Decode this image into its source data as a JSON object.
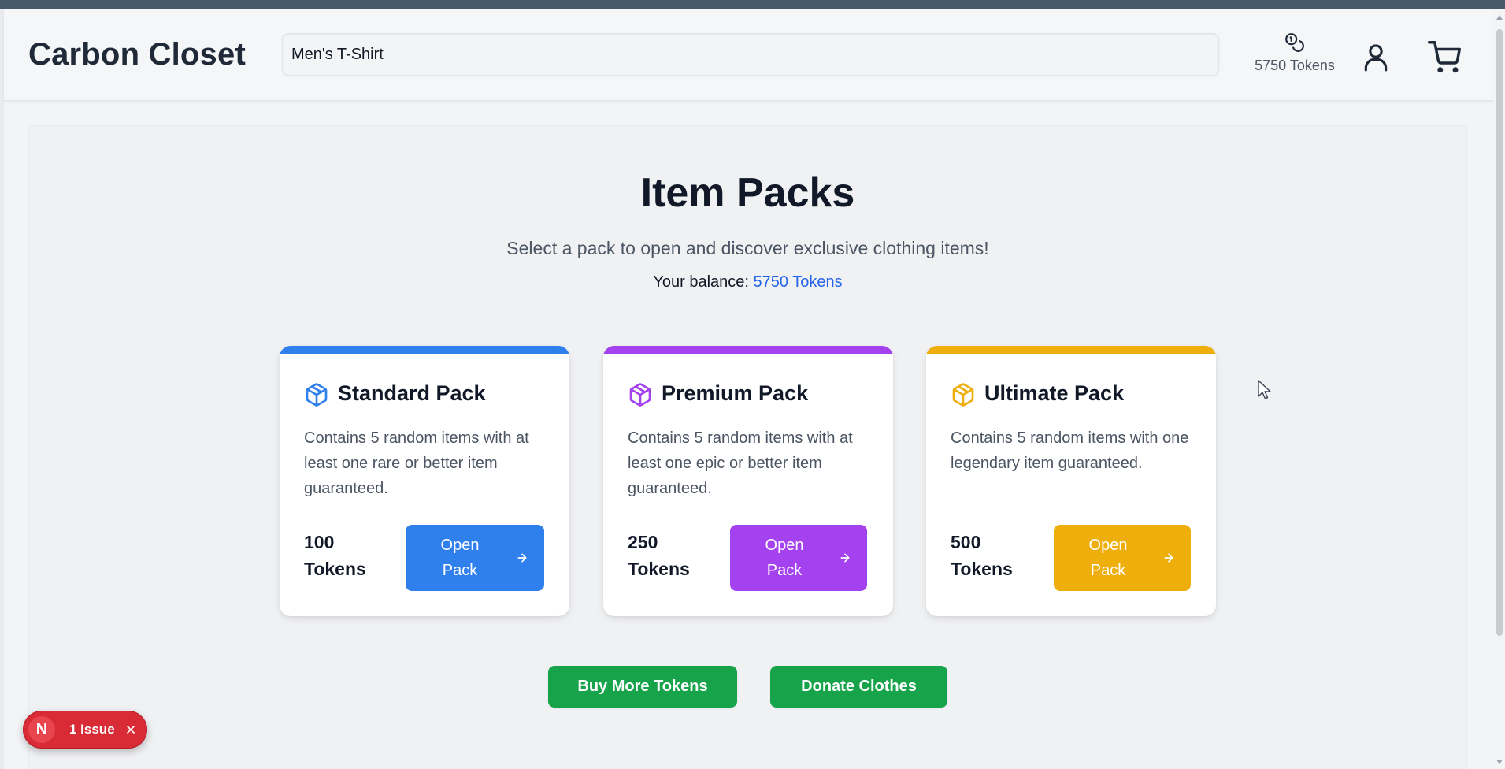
{
  "header": {
    "logo": "Carbon Closet",
    "search": {
      "value": "Men's T-Shirt",
      "placeholder": ""
    },
    "tokens_label": "5750 Tokens"
  },
  "page": {
    "title": "Item Packs",
    "subtitle": "Select a pack to open and discover exclusive clothing items!",
    "balance_label": "Your balance:",
    "balance_value": "5750 Tokens"
  },
  "packs": [
    {
      "name": "Standard Pack",
      "description": "Contains 5 random items with at least one rare or better item guaranteed.",
      "price": "100 Tokens",
      "button_label": "Open Pack",
      "accent": "#2f80ed"
    },
    {
      "name": "Premium Pack",
      "description": "Contains 5 random items with at least one epic or better item guaranteed.",
      "price": "250 Tokens",
      "button_label": "Open Pack",
      "accent": "#a542f0"
    },
    {
      "name": "Ultimate Pack",
      "description": "Contains 5 random items with one legendary item guaranteed.",
      "price": "500 Tokens",
      "button_label": "Open Pack",
      "accent": "#eeae0b"
    }
  ],
  "actions": {
    "buy_tokens": "Buy More Tokens",
    "donate": "Donate Clothes"
  },
  "dev_overlay": {
    "logo_letter": "N",
    "issues_label": "1 Issue"
  },
  "icons": {
    "tokens": "coins-icon",
    "account": "user-icon",
    "cart": "cart-icon",
    "pack": "package-icon",
    "open": "arrow-right-icon",
    "dismiss": "close-icon"
  },
  "colors": {
    "link_blue": "#2563eb",
    "action_green": "#16a34a",
    "issue_red": "#d92b35"
  }
}
